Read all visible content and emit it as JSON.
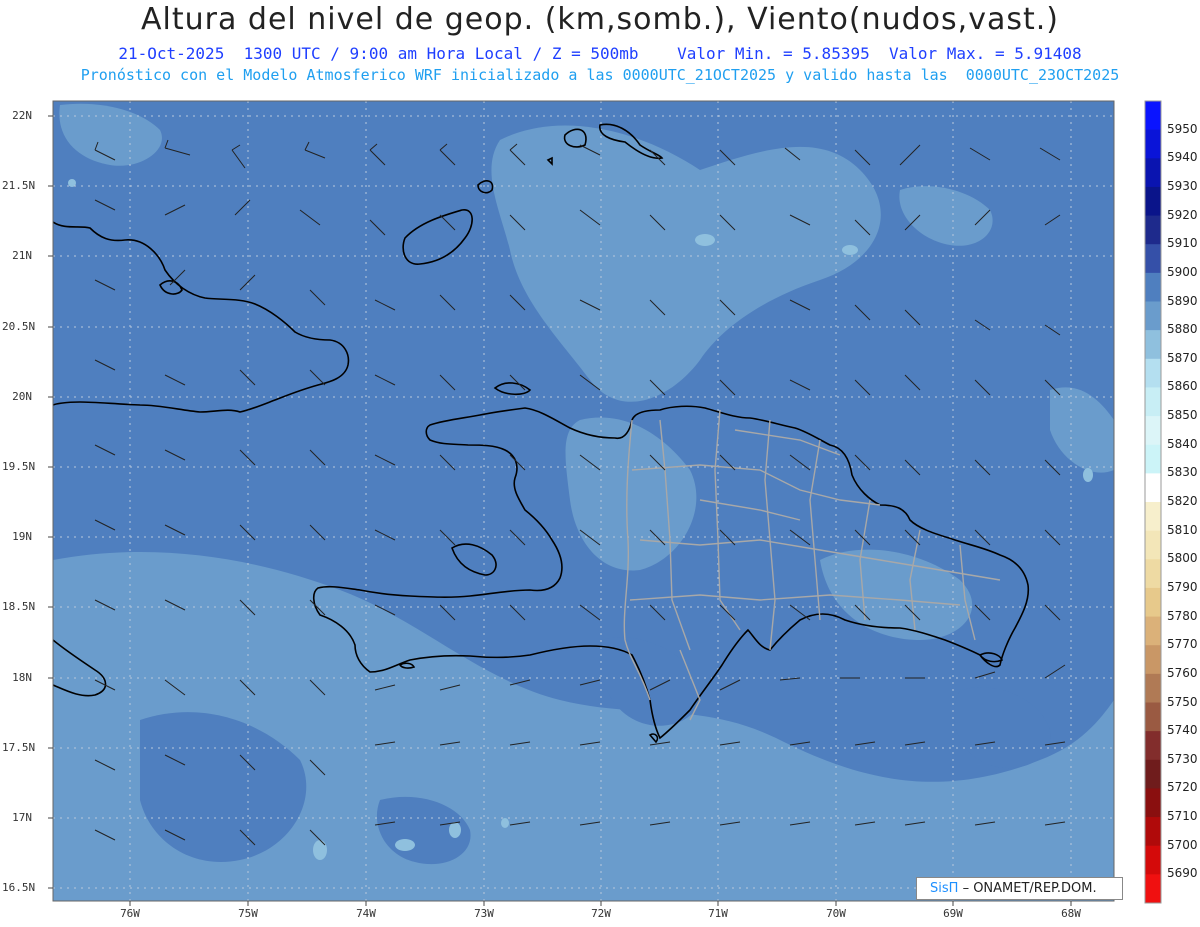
{
  "header": {
    "title": "Altura del nivel de geop. (km,somb.), Viento(nudos,vast.)",
    "subtitle_left": "21-Oct-2025  1300 UTC / 9:00 am Hora Local / Z = 500mb",
    "subtitle_right": "Valor Min. = 5.85395  Valor Max. = 5.91408",
    "subtitle_line2": "Pronóstico con el Modelo Atmosferico WRF inicializado a las 0000UTC_21OCT2025 y valido hasta las  0000UTC_23OCT2025"
  },
  "axes": {
    "lat_labels": [
      "22N",
      "21.5N",
      "21N",
      "20.5N",
      "20N",
      "19.5N",
      "19N",
      "18.5N",
      "18N",
      "17.5N",
      "17N",
      "16.5N"
    ],
    "lon_labels": [
      "76W",
      "75W",
      "74W",
      "73W",
      "72W",
      "71W",
      "70W",
      "69W",
      "68W"
    ]
  },
  "colorbar": {
    "levels": [
      "5950",
      "5940",
      "5930",
      "5920",
      "5910",
      "5900",
      "5890",
      "5880",
      "5870",
      "5860",
      "5850",
      "5840",
      "5830",
      "5820",
      "5810",
      "5800",
      "5790",
      "5780",
      "5770",
      "5760",
      "5750",
      "5740",
      "5730",
      "5720",
      "5710",
      "5700",
      "5690"
    ],
    "colors": [
      "#0a14ff",
      "#0a14d8",
      "#0a14b0",
      "#0a148a",
      "#1e2a8c",
      "#3550a8",
      "#4f7fbf",
      "#6a9ccc",
      "#8fc0de",
      "#b4dff0",
      "#c8eef5",
      "#dcf5f8",
      "#ccf4f8",
      "#ffffff",
      "#f7efcc",
      "#f3e6b8",
      "#eedaa3",
      "#e7c98b",
      "#dbb179",
      "#c99766",
      "#b07a55",
      "#9a5a42",
      "#822d2c",
      "#6f1c1c",
      "#8a0f0f",
      "#b00a0a",
      "#d40a0a",
      "#f01010"
    ]
  },
  "credit": {
    "sis": "SisΠ",
    "org": "– ONAMET/REP.DOM."
  }
}
